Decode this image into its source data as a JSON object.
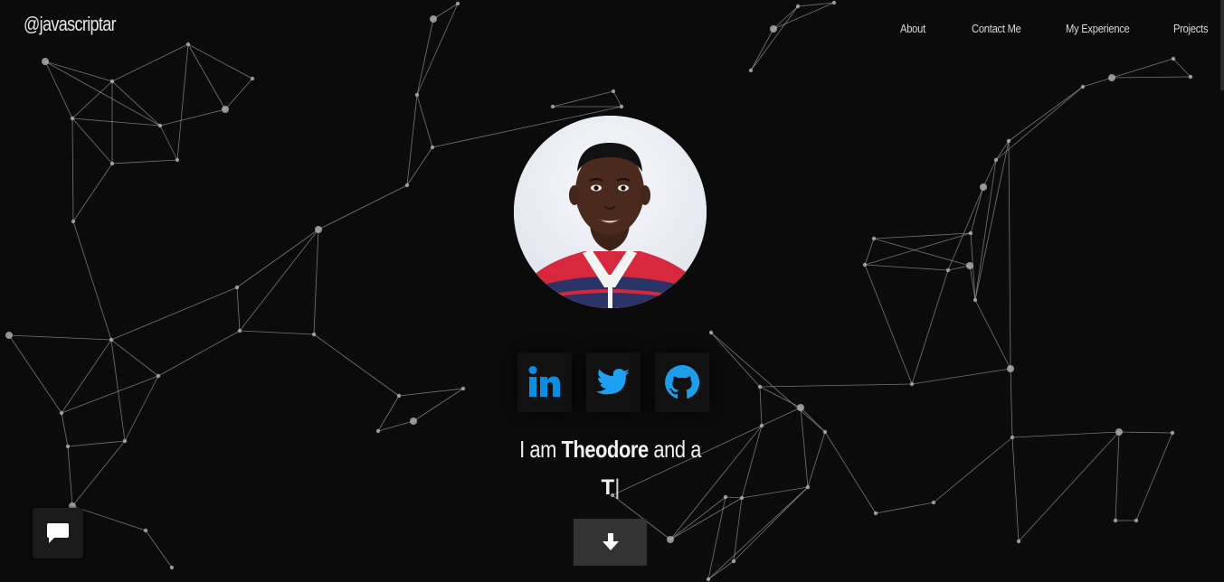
{
  "header": {
    "brand": "@javascriptar",
    "nav": [
      {
        "label": "About"
      },
      {
        "label": "Contact Me"
      },
      {
        "label": "My Experience"
      },
      {
        "label": "Projects"
      }
    ]
  },
  "hero": {
    "avatar_alt": "Theodore",
    "intro_prefix": "I am ",
    "name": "Theodore",
    "intro_suffix": " and a",
    "typed_text": "T",
    "typed_cursor": "|",
    "socials": [
      {
        "name": "LinkedIn",
        "icon": "linkedin-icon",
        "color": "#0a8ee0"
      },
      {
        "name": "Twitter",
        "icon": "twitter-icon",
        "color": "#1da1f2"
      },
      {
        "name": "GitHub",
        "icon": "github-icon",
        "color": "#1e9de8"
      }
    ]
  },
  "controls": {
    "scroll_down_icon": "arrow-down-icon",
    "chat_icon": "chat-bubble-icon"
  },
  "colors": {
    "background": "#0b0b0b",
    "network_line": "#9a9a9a",
    "network_node": "#b5b5b5",
    "accent": "#1da1f2"
  }
}
